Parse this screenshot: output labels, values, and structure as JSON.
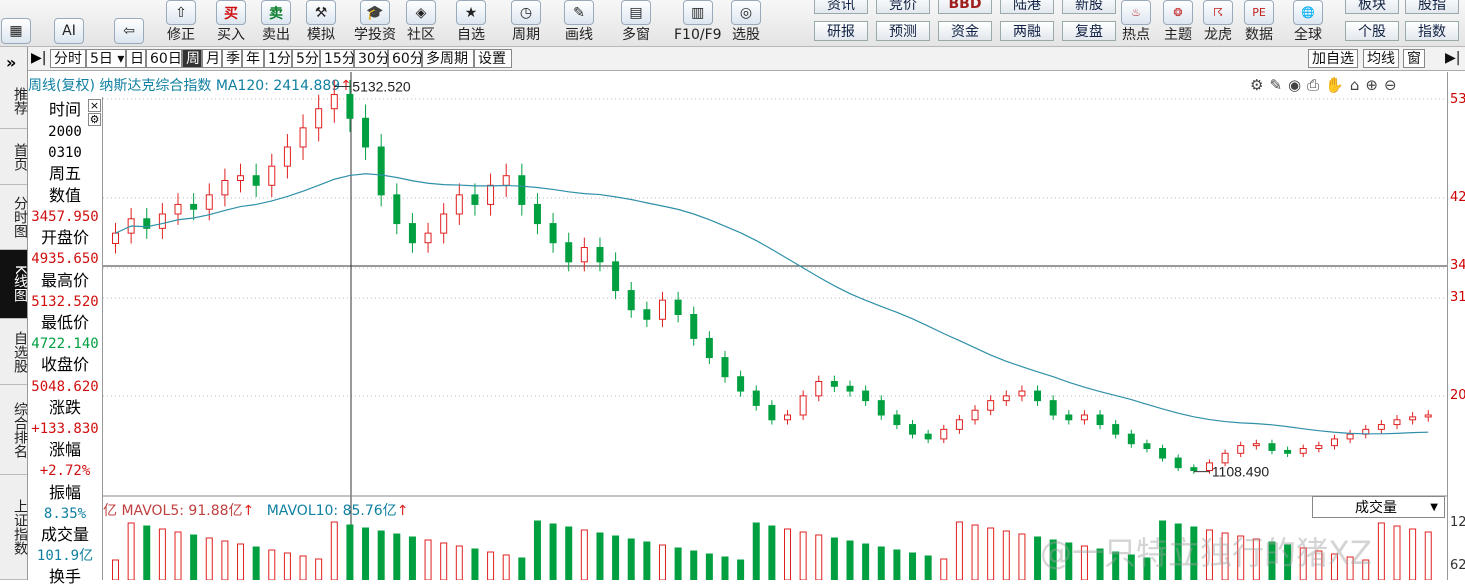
{
  "toolbar": {
    "buttons": [
      {
        "label": "",
        "icon": "windows-icon"
      },
      {
        "label": "",
        "icon": "ai-icon"
      },
      {
        "label": "",
        "icon": "back-arrow-icon"
      },
      {
        "label": "修正",
        "icon": "arrow-updown-icon"
      },
      {
        "label": "买入",
        "icon": "buy-icon",
        "badge": "买"
      },
      {
        "label": "卖出",
        "icon": "sell-icon",
        "badge": "卖"
      },
      {
        "label": "模拟",
        "icon": "hammer-icon"
      },
      {
        "label": "学投资",
        "icon": "graduation-cap-icon"
      },
      {
        "label": "社区",
        "icon": "community-icon"
      },
      {
        "label": "自选",
        "icon": "star-icon"
      },
      {
        "label": "周期",
        "icon": "clock-icon"
      },
      {
        "label": "画线",
        "icon": "pen-icon"
      },
      {
        "label": "多窗",
        "icon": "windows-grid-icon"
      },
      {
        "label": "F10/F9",
        "icon": "document-icon"
      },
      {
        "label": "选股",
        "icon": "chart-search-icon"
      }
    ],
    "text_buttons_top": [
      "资讯",
      "竞价",
      "BBD",
      "陆港",
      "新股"
    ],
    "text_buttons_bottom": [
      "研报",
      "预测",
      "资金",
      "两融",
      "复盘"
    ],
    "right_buttons": [
      {
        "label": "热点",
        "icon": "hot-icon",
        "badge": "HOT"
      },
      {
        "label": "主题",
        "icon": "theme-icon"
      },
      {
        "label": "龙虎",
        "icon": "dragon-icon"
      },
      {
        "label": "数据",
        "icon": "pe-icon",
        "badge": "PE"
      },
      {
        "label": "全球",
        "icon": "globe-icon"
      }
    ],
    "far_right_top": [
      "板块",
      "股指"
    ],
    "far_right_bottom": [
      "个股",
      "指数"
    ]
  },
  "sidebar": {
    "expand": "»",
    "items": [
      {
        "label": "推荐",
        "active": false
      },
      {
        "label": "首页",
        "active": false
      },
      {
        "label": "分时图",
        "active": false
      },
      {
        "label": "K线图",
        "active": true
      },
      {
        "label": "自选股",
        "active": false
      },
      {
        "label": "综合排名",
        "active": false
      },
      {
        "label": "上证指数",
        "active": false
      }
    ]
  },
  "periods": {
    "items": [
      "分时",
      "5日",
      "日",
      "60日",
      "周",
      "月",
      "季",
      "年",
      "1分",
      "5分",
      "15分",
      "30分",
      "60分",
      "多周期",
      "设置"
    ],
    "active": "周",
    "right": [
      "加自选",
      "均线",
      "窗"
    ]
  },
  "chart_header": {
    "title": "周线(复权) 纳斯达克综合指数 MA120: 2414.889",
    "arrow": "↑"
  },
  "info": {
    "time_label": "时间",
    "time_year": "2000",
    "time_date": "0310",
    "time_weekday": "周五",
    "value_label": "数值",
    "value": "3457.950",
    "open_label": "开盘价",
    "open": "4935.650",
    "high_label": "最高价",
    "high": "5132.520",
    "low_label": "最低价",
    "low": "4722.140",
    "close_label": "收盘价",
    "close": "5048.620",
    "change_label": "涨跌",
    "change": "+133.830",
    "pct_label": "涨幅",
    "pct": "+2.72%",
    "amp_label": "振幅",
    "amp": "8.35%",
    "vol_label": "成交量",
    "vol": "101.9亿",
    "turn_label": "换手"
  },
  "yaxis": {
    "labels": [
      "53",
      "42",
      "34",
      "31",
      "20",
      "12",
      "62"
    ]
  },
  "annotations": {
    "high": "5132.520",
    "low": "1108.490"
  },
  "volume": {
    "title": "亿 MAVOL5: 91.88亿",
    "title2": "MAVOL10: 85.76亿",
    "dropdown": "成交量"
  },
  "watermark": "@一只特立独行的猪XZ",
  "colors": {
    "up": "#e02020",
    "down": "#00a040",
    "ma": "#3090a8",
    "title": "#1080a0"
  },
  "chart_data": {
    "type": "candlestick",
    "title": "纳斯达克综合指数 周线(复权)",
    "annotations": [
      {
        "label": "5132.520",
        "type": "high"
      },
      {
        "label": "1108.490",
        "type": "low"
      }
    ],
    "closes": [
      3600,
      3750,
      3650,
      3800,
      3900,
      3850,
      4000,
      4150,
      4200,
      4100,
      4300,
      4500,
      4700,
      4900,
      5048,
      4800,
      4500,
      4000,
      3700,
      3500,
      3600,
      3800,
      4000,
      3900,
      4100,
      4200,
      3900,
      3700,
      3500,
      3300,
      3450,
      3300,
      3000,
      2800,
      2700,
      2900,
      2750,
      2500,
      2300,
      2100,
      1950,
      1800,
      1650,
      1700,
      1900,
      2050,
      2000,
      1950,
      1850,
      1700,
      1600,
      1500,
      1450,
      1550,
      1650,
      1750,
      1850,
      1900,
      1950,
      1850,
      1700,
      1650,
      1700,
      1600,
      1500,
      1400,
      1350,
      1250,
      1150,
      1120,
      1200,
      1300,
      1380,
      1400,
      1330,
      1300,
      1350,
      1380,
      1450,
      1500,
      1550,
      1600,
      1650,
      1680,
      1700
    ]
  }
}
